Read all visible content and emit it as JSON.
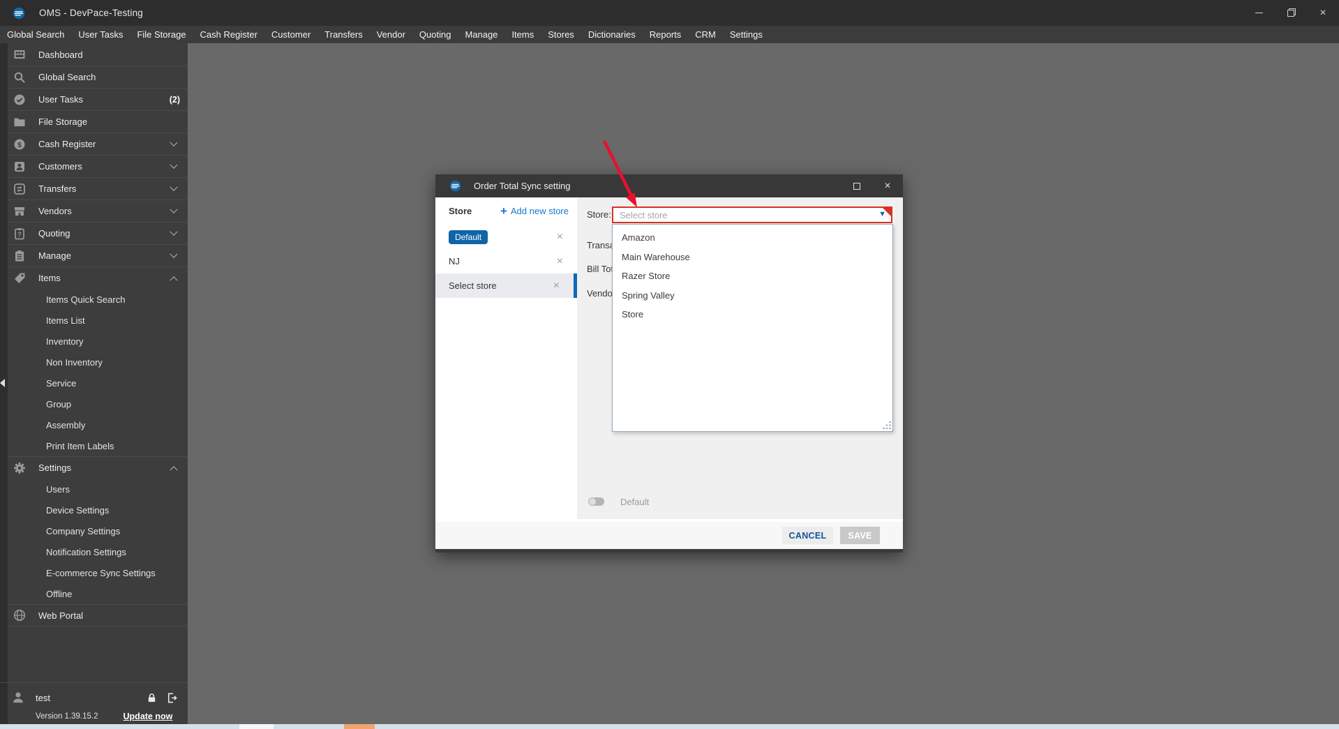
{
  "window": {
    "title": "OMS - DevPace-Testing"
  },
  "menu_bar": {
    "items": [
      "Global Search",
      "User Tasks",
      "File Storage",
      "Cash Register",
      "Customer",
      "Transfers",
      "Vendor",
      "Quoting",
      "Manage",
      "Items",
      "Stores",
      "Dictionaries",
      "Reports",
      "CRM",
      "Settings"
    ]
  },
  "sidebar": {
    "items": [
      {
        "label": "Dashboard",
        "icon": "dashboard"
      },
      {
        "label": "Global Search",
        "icon": "search"
      },
      {
        "label": "User Tasks",
        "icon": "tasks",
        "badge": "(2)"
      },
      {
        "label": "File Storage",
        "icon": "folder"
      },
      {
        "label": "Cash Register",
        "icon": "cash",
        "chevron": "down"
      },
      {
        "label": "Customers",
        "icon": "customers",
        "chevron": "down"
      },
      {
        "label": "Transfers",
        "icon": "transfers",
        "chevron": "down"
      },
      {
        "label": "Vendors",
        "icon": "vendors",
        "chevron": "down"
      },
      {
        "label": "Quoting",
        "icon": "quoting",
        "chevron": "down"
      },
      {
        "label": "Manage",
        "icon": "manage",
        "chevron": "down"
      },
      {
        "label": "Items",
        "icon": "items",
        "chevron": "up"
      },
      {
        "label": "Items Quick Search",
        "sub": true
      },
      {
        "label": "Items List",
        "sub": true
      },
      {
        "label": "Inventory",
        "sub": true
      },
      {
        "label": "Non Inventory",
        "sub": true
      },
      {
        "label": "Service",
        "sub": true
      },
      {
        "label": "Group",
        "sub": true
      },
      {
        "label": "Assembly",
        "sub": true
      },
      {
        "label": "Print Item Labels",
        "sub": true
      },
      {
        "label": "Settings",
        "icon": "settings",
        "chevron": "up"
      },
      {
        "label": "Users",
        "sub": true
      },
      {
        "label": "Device Settings",
        "sub": true
      },
      {
        "label": "Company Settings",
        "sub": true
      },
      {
        "label": "Notification Settings",
        "sub": true
      },
      {
        "label": "E-commerce Sync Settings",
        "sub": true
      },
      {
        "label": "Offline",
        "sub": true
      },
      {
        "label": "Web Portal",
        "icon": "globe",
        "last": true
      }
    ],
    "user": {
      "name": "test"
    },
    "footer": {
      "version": "Version 1.39.15.2",
      "update": "Update now"
    }
  },
  "modal": {
    "title": "Order Total Sync setting",
    "left_panel": {
      "header": "Store",
      "add_store": "Add new store",
      "stores": [
        {
          "label": "Default",
          "chip": true
        },
        {
          "label": "NJ"
        },
        {
          "label": "Select store",
          "selected": true
        }
      ]
    },
    "right_panel": {
      "store_label": "Store:",
      "combo_placeholder": "Select store",
      "clipped_labels": [
        "Transa",
        "Bill Tot",
        "Vendo"
      ],
      "options": [
        "Amazon",
        "Main Warehouse",
        "Razer Store",
        "Spring Valley",
        "Store"
      ],
      "toggle_label": "Default"
    },
    "footer": {
      "cancel": "CANCEL",
      "save": "SAVE"
    }
  },
  "colors": {
    "accent_blue": "#1976d2",
    "chip_blue": "#1065a7",
    "selection_bar_blue": "#1268b3",
    "combo_error_red": "#d93025",
    "annotation_red": "#e8112d",
    "titlebar": "#2d2d2d",
    "sidebar": "#3d3d3d",
    "content_bg": "#696969"
  }
}
